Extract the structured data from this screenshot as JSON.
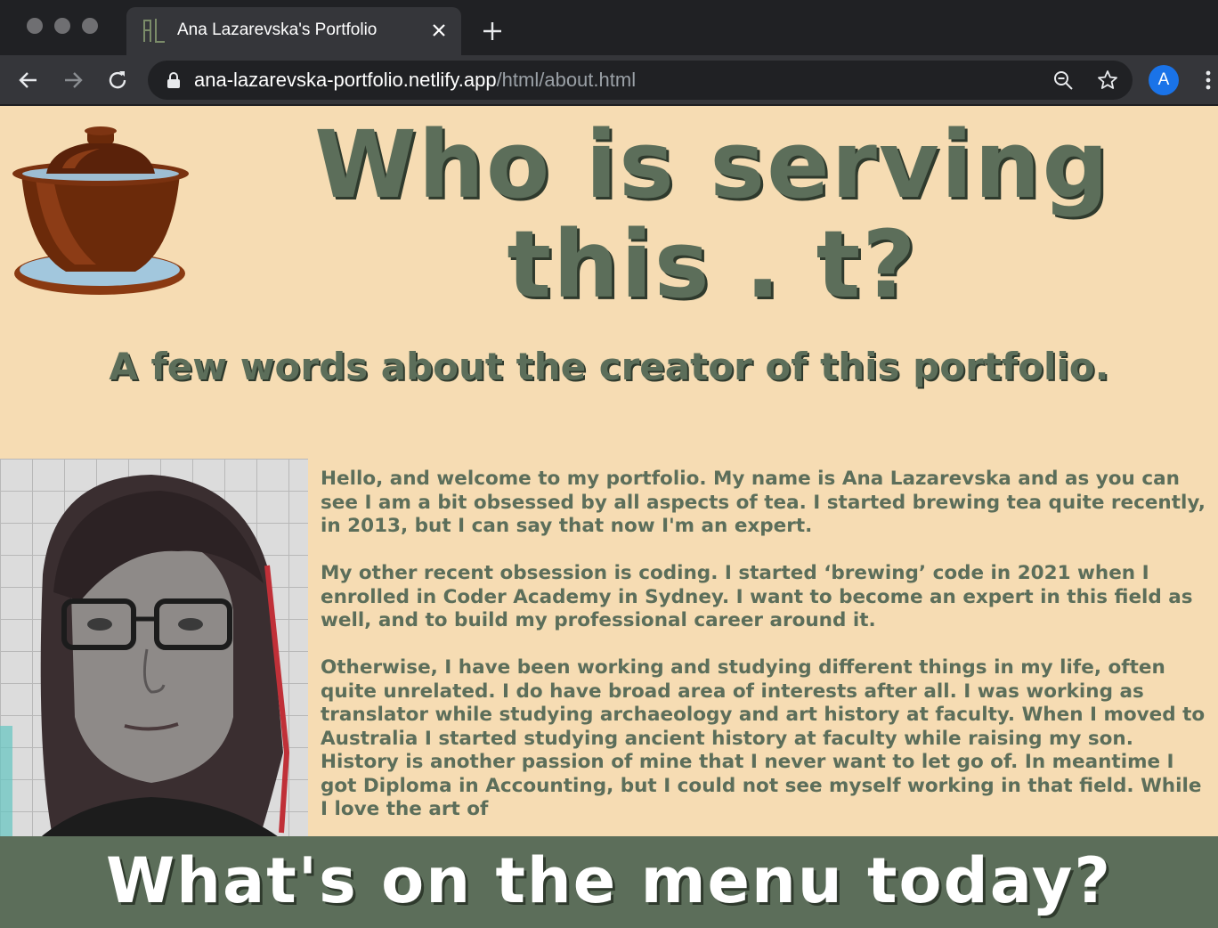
{
  "browser": {
    "tab": {
      "favicon_text": "AL",
      "title": "Ana Lazarevska's Portfolio"
    },
    "address_bar": {
      "host": "ana-lazarevska-portfolio.netlify.app",
      "path": "/html/about.html"
    },
    "profile_initial": "A"
  },
  "page": {
    "hero_title": "Who is serving this . t?",
    "subtitle": "A few words about the creator of this portfolio.",
    "bio_paragraphs": [
      "Hello, and welcome to my portfolio. My name is Ana Lazarevska and as you can see I am a bit obsessed by all aspects of tea. I started brewing tea quite recently, in 2013, but I can say that now I'm an expert.",
      "My other recent obsession is coding. I started ‘brewing’ code in 2021 when I enrolled in Coder Academy in Sydney. I want to become an expert in this field as well, and to build my professional career around it.",
      "Otherwise, I have been working and studying different things in my life, often quite unrelated. I do have broad area of interests after all. I was working as translator while studying archaeology and art history at faculty. When I moved to Australia I started studying ancient history at faculty while raising my son. History is another passion of mine that I never want to let go of. In meantime I got Diploma in Accounting, but I could not see myself working in that field. While I love the art of"
    ],
    "menu_banner": "What's on the menu today?"
  },
  "colors": {
    "page_background": "#f6dcb3",
    "accent_green": "#5c6e5a",
    "shadow_green": "#2f3a2d"
  },
  "icons": {
    "favicon": "al-monogram-icon",
    "logo": "gaiwan-teacup-icon",
    "photo": "author-portrait"
  }
}
